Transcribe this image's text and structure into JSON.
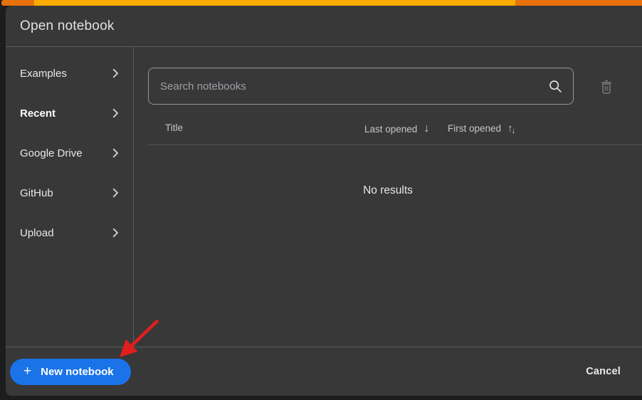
{
  "window": {
    "title": "Open notebook"
  },
  "loading_bar": {
    "amber": "#F9AB00",
    "orange": "#E8710A"
  },
  "sidebar": {
    "items": [
      {
        "label": "Examples",
        "active": false
      },
      {
        "label": "Recent",
        "active": true
      },
      {
        "label": "Google Drive",
        "active": false
      },
      {
        "label": "GitHub",
        "active": false
      },
      {
        "label": "Upload",
        "active": false
      }
    ]
  },
  "search": {
    "placeholder": "Search notebooks",
    "value": ""
  },
  "table": {
    "columns": [
      {
        "label": "Title",
        "sort": "none"
      },
      {
        "label": "Last opened",
        "sort": "desc"
      },
      {
        "label": "First opened",
        "sort": "both"
      }
    ],
    "rows": [],
    "empty_text": "No results"
  },
  "icons": {
    "sort_desc_glyph": "↓",
    "sort_up_glyph": "↑",
    "sort_down_glyph": "↓",
    "plus_glyph": "+"
  },
  "footer": {
    "new_notebook_label": "New notebook",
    "cancel_label": "Cancel"
  },
  "annotation": {
    "type": "arrow",
    "color": "#E01E1E"
  },
  "colors": {
    "accent_blue": "#1A73E8",
    "panel": "#383838",
    "page": "#1C1D1E"
  }
}
